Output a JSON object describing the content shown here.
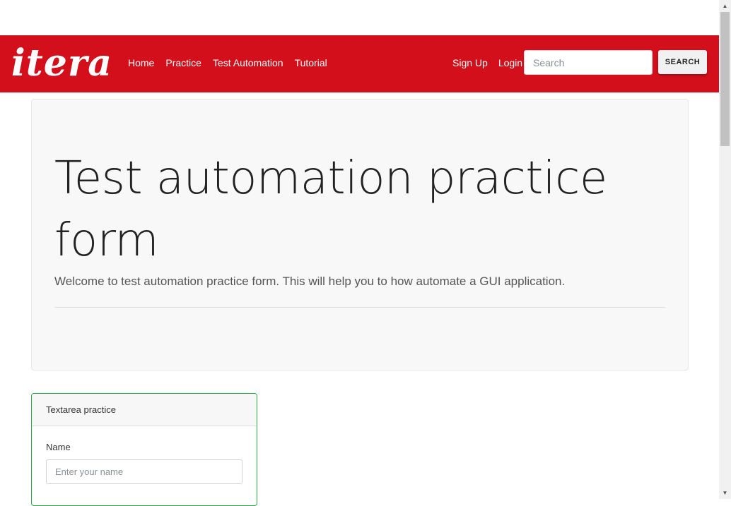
{
  "brand": {
    "logo_text": "itera"
  },
  "nav": {
    "links": [
      "Home",
      "Practice",
      "Test Automation",
      "Tutorial"
    ],
    "right_links": [
      "Sign Up",
      "Login"
    ]
  },
  "search": {
    "placeholder": "Search",
    "button_label": "SEARCH"
  },
  "jumbotron": {
    "title": "Test automation practice form",
    "lead": "Welcome to test automation practice form. This will help you to how automate a GUI application."
  },
  "textarea_card": {
    "header": "Textarea practice",
    "name_label": "Name",
    "name_placeholder": "Enter your name"
  },
  "colors": {
    "navbar": "#d20f1a",
    "card_border": "#28a745",
    "jumbotron_bg": "#f8f8f8"
  },
  "icons": {
    "scroll_up": "triangle-up",
    "scroll_down": "triangle-down"
  }
}
